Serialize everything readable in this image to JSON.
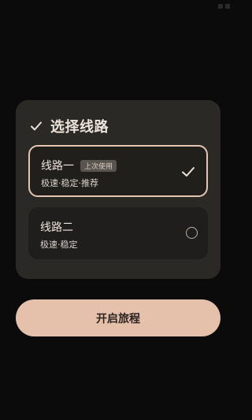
{
  "dialog": {
    "title": "选择线路",
    "header_icon": "check-icon"
  },
  "routes": [
    {
      "name": "线路一",
      "badge": "上次使用",
      "description": "极速·稳定·推荐",
      "selected": true,
      "indicator_icon": "check-icon"
    },
    {
      "name": "线路二",
      "description": "极速·稳定",
      "selected": false,
      "indicator_icon": "radio-circle-icon"
    }
  ],
  "start_button": {
    "label": "开启旅程"
  },
  "colors": {
    "background": "#0b0b0b",
    "dialog": "#2b2925",
    "selected_border": "#e2c6b2",
    "button": "#e5c0ab"
  }
}
